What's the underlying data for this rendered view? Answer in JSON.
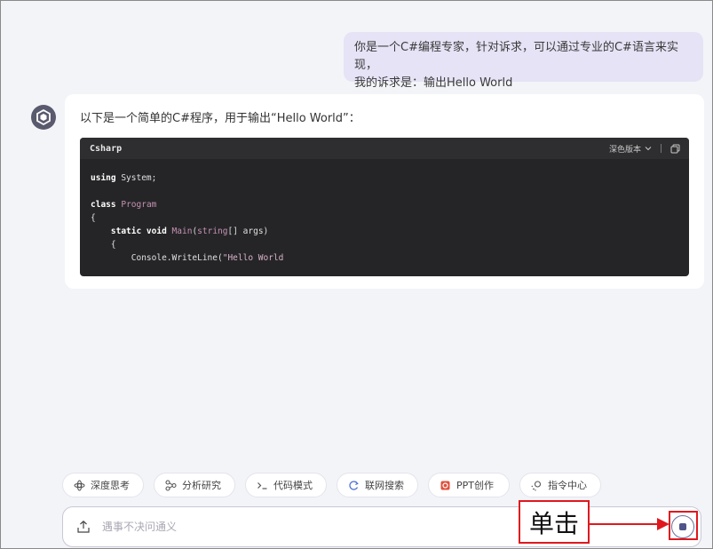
{
  "user_message": {
    "line1": "你是一个C#编程专家，针对诉求，可以通过专业的C#语言来实现，",
    "line2": "我的诉求是：输出Hello World"
  },
  "assistant": {
    "avatar_icon": "assistant-logo-icon",
    "intro": "以下是一个简单的C#程序，用于输出“Hello World”：",
    "code": {
      "language": "Csharp",
      "theme_label": "深色版本",
      "theme_icon": "chevron-down-icon",
      "copy_icon": "copy-icon",
      "lines": {
        "l1_kw": "using",
        "l1_rest": " System;",
        "l3_kw": "class",
        "l3_type": "Program",
        "l4": "{",
        "l5_indent": "    ",
        "l5_kw": "static void",
        "l5_fn": "Main",
        "l5_type": "string",
        "l5_rest": "[] args)",
        "l6": "    {",
        "l7_pre": "        Console.WriteLine(",
        "l7_str": "\"Hello World"
      }
    }
  },
  "chips": [
    {
      "label": "深度思考",
      "icon": "deep-think-icon"
    },
    {
      "label": "分析研究",
      "icon": "analysis-icon"
    },
    {
      "label": "代码模式",
      "icon": "terminal-icon"
    },
    {
      "label": "联网搜索",
      "icon": "web-search-icon"
    },
    {
      "label": "PPT创作",
      "icon": "ppt-icon"
    },
    {
      "label": "指令中心",
      "icon": "command-center-icon"
    }
  ],
  "input": {
    "placeholder": "遇事不决问通义",
    "value": "",
    "upload_icon": "upload-icon",
    "stop_icon": "stop-icon"
  },
  "annotation": {
    "label": "单击",
    "color": "#e0181e"
  },
  "colors": {
    "background": "#f3f4f8",
    "user_bubble": "#e5e3f5",
    "code_bg": "#252527",
    "accent": "#4f5588"
  }
}
